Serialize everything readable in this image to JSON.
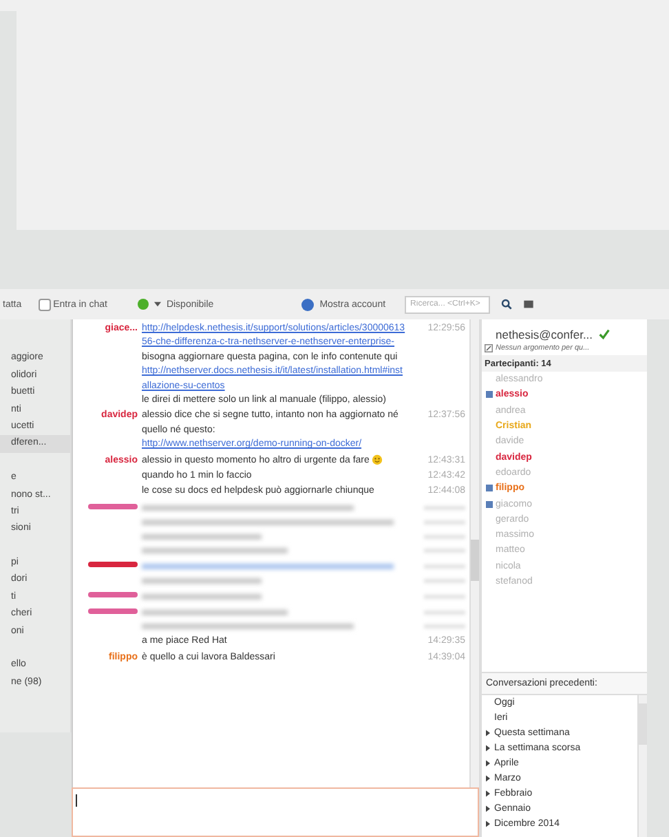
{
  "toolbar": {
    "contact_label": "tatta",
    "join_checkbox": {
      "label": "Entra in chat",
      "checked": false
    },
    "status": {
      "label": "Disponibile",
      "color": "#4caf2a"
    },
    "account_button": "Mostra account",
    "search": {
      "placeholder": "Ricerca... <Ctrl+K>"
    }
  },
  "sidebar": {
    "items": [
      {
        "kind": "gap"
      },
      {
        "kind": "item",
        "label": "aggiore",
        "selected": false
      },
      {
        "kind": "item",
        "label": "olidori",
        "selected": false
      },
      {
        "kind": "item",
        "label": "buetti",
        "selected": false
      },
      {
        "kind": "item",
        "label": "nti",
        "selected": false
      },
      {
        "kind": "item",
        "label": "ucetti",
        "selected": false
      },
      {
        "kind": "item",
        "label": "dferen...",
        "selected": true
      },
      {
        "kind": "gap"
      },
      {
        "kind": "item",
        "label": "e",
        "selected": false
      },
      {
        "kind": "item",
        "label": "nono st...",
        "selected": false
      },
      {
        "kind": "item",
        "label": "tri",
        "selected": false
      },
      {
        "kind": "item",
        "label": "sioni",
        "selected": false
      },
      {
        "kind": "gap"
      },
      {
        "kind": "item",
        "label": "pi",
        "selected": false
      },
      {
        "kind": "item",
        "label": "dori",
        "selected": false
      },
      {
        "kind": "item",
        "label": "ti",
        "selected": false
      },
      {
        "kind": "item",
        "label": "cheri",
        "selected": false
      },
      {
        "kind": "item",
        "label": "oni",
        "selected": false
      },
      {
        "kind": "gap"
      },
      {
        "kind": "item",
        "label": "ello",
        "selected": false
      },
      {
        "kind": "item",
        "label": "ne (98)",
        "selected": false
      }
    ]
  },
  "messages": [
    {
      "kind": "text",
      "sender": "giace...",
      "color": "#d8263f",
      "time": "12:29:56",
      "parts": [
        {
          "kind": "link",
          "text": "http://helpdesk.nethesis.it/support/solutions/articles/3000061356-che-differenza-c-tra-nethserver-e-nethserver-enterprise-"
        },
        {
          "kind": "plain",
          "text": " bisogna aggiornare questa pagina, con le info contenute qui "
        },
        {
          "kind": "link",
          "text": "http://nethserver.docs.nethesis.it/it/latest/installation.html#installazione-su-centos"
        },
        {
          "kind": "plain",
          "text": " le direi di mettere solo un link al manuale (filippo, alessio)"
        }
      ]
    },
    {
      "kind": "text",
      "sender": "davidep",
      "color": "#d8263f",
      "time": "12:37:56",
      "parts": [
        {
          "kind": "plain",
          "text": "alessio dice che si segne tutto, intanto non ha aggiornato né quello né questo: "
        },
        {
          "kind": "link",
          "text": "http://www.nethserver.org/demo-running-on-docker/"
        }
      ]
    },
    {
      "kind": "text",
      "sender": "alessio",
      "color": "#d8263f",
      "time": "12:43:31",
      "smiley": true,
      "parts": [
        {
          "kind": "plain",
          "text": "alessio in questo momento ho altro di urgente da fare "
        }
      ]
    },
    {
      "kind": "text",
      "time": "12:43:42",
      "parts": [
        {
          "kind": "plain",
          "text": "quando ho 1 min lo faccio"
        }
      ]
    },
    {
      "kind": "text",
      "time": "12:44:08",
      "parts": [
        {
          "kind": "plain",
          "text": "le  cose su docs ed helpdesk può aggiornarle chiunque"
        }
      ]
    },
    {
      "kind": "redacted",
      "color": "#e0609a",
      "lines": [
        {
          "kind": "text"
        },
        {
          "kind": "text"
        },
        {
          "kind": "text"
        },
        {
          "kind": "text"
        }
      ]
    },
    {
      "kind": "redacted",
      "color": "#d8263f",
      "lines": [
        {
          "kind": "link"
        },
        {
          "kind": "text"
        }
      ]
    },
    {
      "kind": "redacted",
      "color": "#e0609a",
      "lines": [
        {
          "kind": "text"
        }
      ]
    },
    {
      "kind": "redacted",
      "color": "#e0609a",
      "lines": [
        {
          "kind": "text"
        },
        {
          "kind": "text"
        }
      ]
    },
    {
      "kind": "text",
      "time": "14:29:35",
      "parts": [
        {
          "kind": "plain",
          "text": "a me piace Red Hat"
        }
      ]
    },
    {
      "kind": "text",
      "sender": "filippo",
      "color": "#e8701a",
      "time": "14:39:04",
      "parts": [
        {
          "kind": "plain",
          "text": "è quello a cui lavora Baldessari"
        }
      ]
    }
  ],
  "room": {
    "name": "nethesis@confer...",
    "topic": "Nessun argomento per qu...",
    "participants_label": "Partecipanti: 14",
    "participants": [
      {
        "name": "alessandro",
        "color": "#b0b0b0",
        "moderator": false
      },
      {
        "name": "alessio",
        "color": "#d8263f",
        "moderator": true
      },
      {
        "name": "andrea",
        "color": "#b0b0b0",
        "moderator": false
      },
      {
        "name": "Cristian",
        "color": "#e8a81a",
        "moderator": false
      },
      {
        "name": "davide",
        "color": "#b0b0b0",
        "moderator": false
      },
      {
        "name": "davidep",
        "color": "#d8263f",
        "moderator": false
      },
      {
        "name": "edoardo",
        "color": "#b0b0b0",
        "moderator": false
      },
      {
        "name": "filippo",
        "color": "#e8701a",
        "moderator": true
      },
      {
        "name": "giacomo",
        "color": "#b0b0b0",
        "moderator": true
      },
      {
        "name": "gerardo",
        "color": "#b0b0b0",
        "moderator": false
      },
      {
        "name": "massimo",
        "color": "#b0b0b0",
        "moderator": false
      },
      {
        "name": "matteo",
        "color": "#b0b0b0",
        "moderator": false
      },
      {
        "name": "nicola",
        "color": "#b0b0b0",
        "moderator": false
      },
      {
        "name": "stefanod",
        "color": "#b0b0b0",
        "moderator": false
      }
    ]
  },
  "history": {
    "title": "Conversazioni precedenti:",
    "items": [
      {
        "label": "Oggi",
        "expandable": false
      },
      {
        "label": "Ieri",
        "expandable": false
      },
      {
        "label": "Questa settimana",
        "expandable": true
      },
      {
        "label": "La settimana scorsa",
        "expandable": true
      },
      {
        "label": "Aprile",
        "expandable": true
      },
      {
        "label": "Marzo",
        "expandable": true
      },
      {
        "label": "Febbraio",
        "expandable": true
      },
      {
        "label": "Gennaio",
        "expandable": true
      },
      {
        "label": "Dicembre 2014",
        "expandable": true
      }
    ]
  }
}
